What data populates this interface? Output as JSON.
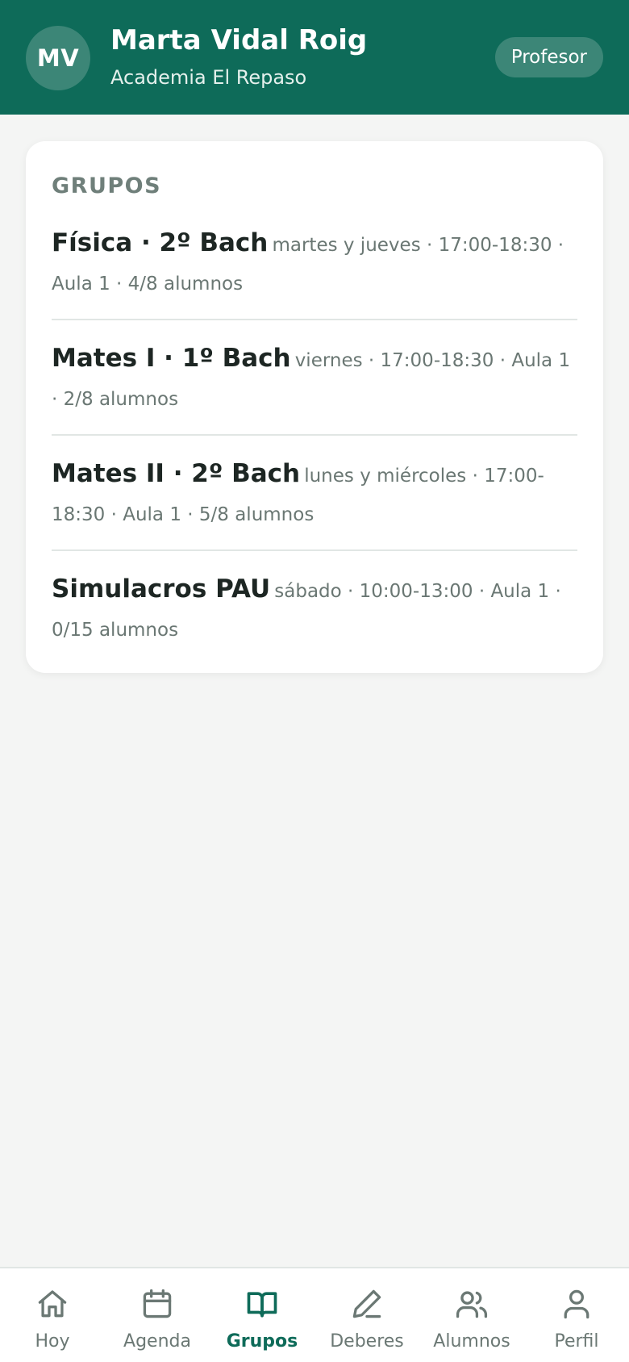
{
  "header": {
    "avatar_initials": "MV",
    "name": "Marta Vidal Roig",
    "organization": "Academia El Repaso",
    "role": "Profesor",
    "background_color": "#0e6b59"
  },
  "groups_section": {
    "title": "GRUPOS",
    "items": [
      {
        "name": "Física · 2º Bach",
        "details": "martes y jueves · 17:00-18:30 · Aula 1 · 4/8 alumnos"
      },
      {
        "name": "Mates I · 1º Bach",
        "details": "viernes · 17:00-18:30 · Aula 1 · 2/8 alumnos"
      },
      {
        "name": "Mates II · 2º Bach",
        "details": "lunes y miércoles · 17:00-18:30 · Aula 1 · 5/8 alumnos"
      },
      {
        "name": "Simulacros PAU",
        "details": "sábado · 10:00-13:00 · Aula 1 · 0/15 alumnos"
      }
    ]
  },
  "bottom_nav": {
    "active": "Grupos",
    "active_color": "#0e6b59",
    "items": [
      {
        "label": "Hoy",
        "icon": "home-icon"
      },
      {
        "label": "Agenda",
        "icon": "calendar-icon"
      },
      {
        "label": "Grupos",
        "icon": "book-icon"
      },
      {
        "label": "Deberes",
        "icon": "pencil-icon"
      },
      {
        "label": "Alumnos",
        "icon": "users-icon"
      },
      {
        "label": "Perfil",
        "icon": "user-icon"
      }
    ]
  }
}
